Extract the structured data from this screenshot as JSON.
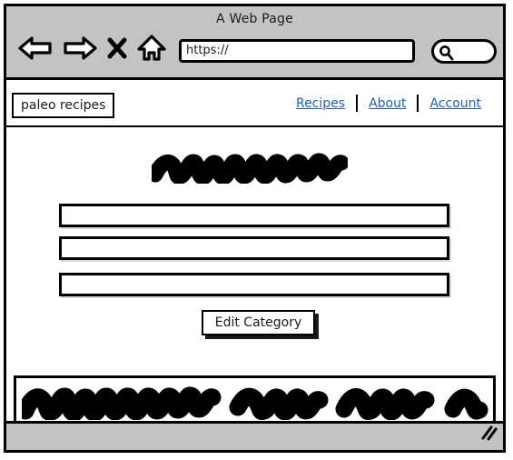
{
  "browser": {
    "title": "A Web Page",
    "url_value": "https://",
    "url_placeholder": "https://",
    "search_placeholder": "",
    "search_value": "",
    "controls": [
      {
        "name": "back-icon",
        "label": "Back"
      },
      {
        "name": "forward-icon",
        "label": "Forward"
      },
      {
        "name": "stop-icon",
        "label": "Stop"
      },
      {
        "name": "home-icon",
        "label": "Home"
      }
    ],
    "search_icon": "search-icon",
    "resize_icon": "resize-grip-icon"
  },
  "site": {
    "logo_text": "paleo recipes",
    "nav": [
      {
        "label": "Recipes"
      },
      {
        "label": "About"
      },
      {
        "label": "Account"
      }
    ],
    "nav_separator": "|"
  },
  "main": {
    "heading": {
      "type": "scribble-placeholder",
      "words": 1,
      "alt": "scribbled heading placeholder"
    },
    "fields": [
      {
        "name": "field-1",
        "value": "",
        "placeholder": ""
      },
      {
        "name": "field-2",
        "value": "",
        "placeholder": ""
      },
      {
        "name": "field-3",
        "value": "",
        "placeholder": ""
      }
    ],
    "button": {
      "label": "Edit Category"
    }
  },
  "footer": {
    "content": {
      "type": "scribble-placeholder",
      "word_groups": 4,
      "alt": "scribbled footer text placeholder"
    }
  },
  "colors": {
    "chrome": "#c3c3c3",
    "ink": "#000000",
    "link": "#1f5fb4",
    "paper": "#ffffff"
  }
}
